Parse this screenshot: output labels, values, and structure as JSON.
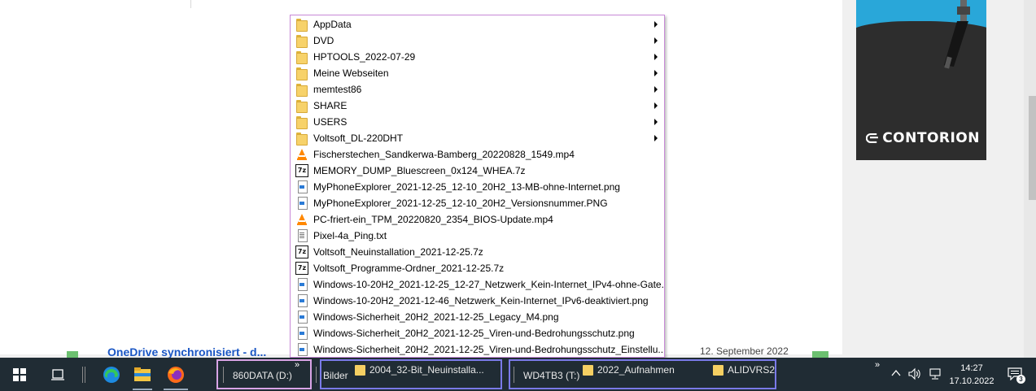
{
  "menu": {
    "items": [
      {
        "icon": "folder-icon",
        "label": "AppData",
        "submenu": true
      },
      {
        "icon": "folder-icon",
        "label": "DVD",
        "submenu": true
      },
      {
        "icon": "folder-icon",
        "label": "HPTOOLS_2022-07-29",
        "submenu": true
      },
      {
        "icon": "folder-icon",
        "label": "Meine Webseiten",
        "submenu": true
      },
      {
        "icon": "folder-icon",
        "label": "memtest86",
        "submenu": true
      },
      {
        "icon": "folder-icon",
        "label": "SHARE",
        "submenu": true
      },
      {
        "icon": "folder-icon",
        "label": "USERS",
        "submenu": true
      },
      {
        "icon": "folder-icon",
        "label": "Voltsoft_DL-220DHT",
        "submenu": true
      },
      {
        "icon": "vlc-icon",
        "label": "Fischerstechen_Sandkerwa-Bamberg_20220828_1549.mp4",
        "submenu": false
      },
      {
        "icon": "7z-archive-icon",
        "label": "MEMORY_DUMP_Bluescreen_0x124_WHEA.7z",
        "submenu": false
      },
      {
        "icon": "png-file-icon",
        "label": "MyPhoneExplorer_2021-12-25_12-10_20H2_13-MB-ohne-Internet.png",
        "submenu": false
      },
      {
        "icon": "png-file-icon",
        "label": "MyPhoneExplorer_2021-12-25_12-10_20H2_Versionsnummer.PNG",
        "submenu": false
      },
      {
        "icon": "vlc-icon",
        "label": "PC-friert-ein_TPM_20220820_2354_BIOS-Update.mp4",
        "submenu": false
      },
      {
        "icon": "text-file-icon",
        "label": "Pixel-4a_Ping.txt",
        "submenu": false
      },
      {
        "icon": "7z-archive-icon",
        "label": "Voltsoft_Neuinstallation_2021-12-25.7z",
        "submenu": false
      },
      {
        "icon": "7z-archive-icon",
        "label": "Voltsoft_Programme-Ordner_2021-12-25.7z",
        "submenu": false
      },
      {
        "icon": "png-file-icon",
        "label": "Windows-10-20H2_2021-12-25_12-27_Netzwerk_Kein-Internet_IPv4-ohne-Gate...",
        "submenu": false
      },
      {
        "icon": "png-file-icon",
        "label": "Windows-10-20H2_2021-12-46_Netzwerk_Kein-Internet_IPv6-deaktiviert.png",
        "submenu": false
      },
      {
        "icon": "png-file-icon",
        "label": "Windows-Sicherheit_20H2_2021-12-25_Legacy_M4.png",
        "submenu": false
      },
      {
        "icon": "png-file-icon",
        "label": "Windows-Sicherheit_20H2_2021-12-25_Viren-und-Bedrohungsschutz.png",
        "submenu": false
      },
      {
        "icon": "png-file-icon",
        "label": "Windows-Sicherheit_20H2_2021-12-25_Viren-und-Bedrohungsschutz_Einstellu...",
        "submenu": false
      }
    ]
  },
  "background": {
    "blue_text": "OneDrive synchronisiert - d...",
    "date_text": "12. September 2022"
  },
  "ad": {
    "brand": "CONTORION",
    "colors": {
      "sky": "#29a7d9",
      "ground": "#2d2d2d"
    }
  },
  "taskbar": {
    "toolbar1": {
      "label": "860DATA (D:)",
      "chevron": "»"
    },
    "toolbar2": {
      "label": "Bilder",
      "folder": "2004_32-Bit_Neuinstalla..."
    },
    "toolbar3": {
      "label": "WD4TB3 (T:)",
      "folders": [
        "2022_Aufnahmen",
        "ALIDVRS2"
      ]
    },
    "tray": {
      "overflow_chevron": "»",
      "time": "14:27",
      "date": "17.10.2022",
      "notification_count": "3"
    },
    "colors": {
      "background": "#202c34",
      "highlight1": "#d9a4e6",
      "highlight2": "#7a7ae8"
    }
  }
}
